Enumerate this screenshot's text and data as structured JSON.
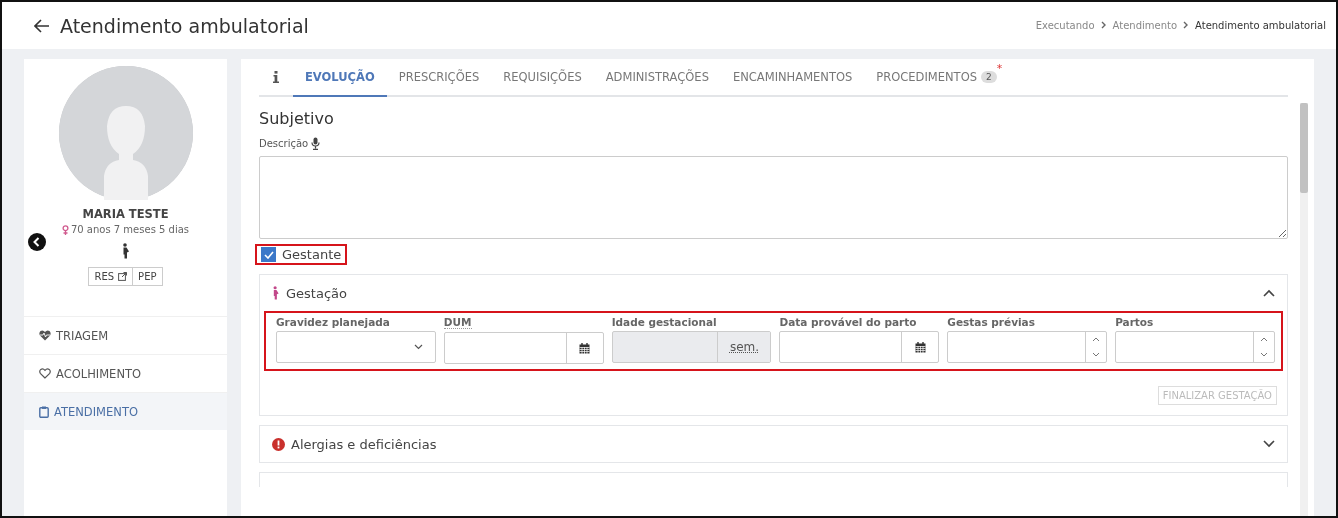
{
  "header": {
    "title": "Atendimento ambulatorial",
    "breadcrumb": [
      {
        "label": "Executando",
        "current": false
      },
      {
        "label": "Atendimento",
        "current": false
      },
      {
        "label": "Atendimento ambulatorial",
        "current": true
      }
    ]
  },
  "patient": {
    "name": "MARIA TESTE",
    "age": "70 anos 7 meses 5 dias",
    "buttons": [
      {
        "label": "RES",
        "external": true
      },
      {
        "label": "PEP",
        "external": false
      }
    ]
  },
  "sidebar": {
    "items": [
      {
        "label": "TRIAGEM",
        "kind": "triage",
        "selected": false
      },
      {
        "label": "ACOLHIMENTO",
        "kind": "welcome",
        "selected": false
      },
      {
        "label": "ATENDIMENTO",
        "kind": "care",
        "selected": true
      }
    ]
  },
  "tabs": [
    {
      "label": "EVOLUÇÃO",
      "selected": true
    },
    {
      "label": "PRESCRIÇÕES",
      "selected": false
    },
    {
      "label": "REQUISIÇÕES",
      "selected": false
    },
    {
      "label": "ADMINISTRAÇÕES",
      "selected": false
    },
    {
      "label": "ENCAMINHAMENTOS",
      "selected": false
    },
    {
      "label": "PROCEDIMENTOS",
      "selected": false,
      "badge": "2",
      "required": "*"
    }
  ],
  "section_title": "Subjetivo",
  "description_label": "Descrição",
  "pregnant": {
    "label": "Gestante",
    "checked": true
  },
  "panels": [
    {
      "title": "Gestação",
      "kind": "pregnancy",
      "expanded": true,
      "fields": [
        {
          "label": "Gravidez planejada",
          "kind": "select",
          "disabled": false
        },
        {
          "label": "DUM",
          "kind": "date",
          "disabled": false
        },
        {
          "label": "Idade gestacional",
          "kind": "unit",
          "unit": "sem.",
          "disabled": true
        },
        {
          "label": "Data provável do parto",
          "kind": "date",
          "disabled": false
        },
        {
          "label": "Gestas prévias",
          "kind": "number",
          "disabled": false
        },
        {
          "label": "Partos",
          "kind": "number",
          "disabled": false
        }
      ],
      "action": {
        "label": "FINALIZAR GESTAÇÃO",
        "disabled": true
      }
    },
    {
      "title": "Alergias e deficiências",
      "kind": "alert",
      "expanded": false
    }
  ]
}
